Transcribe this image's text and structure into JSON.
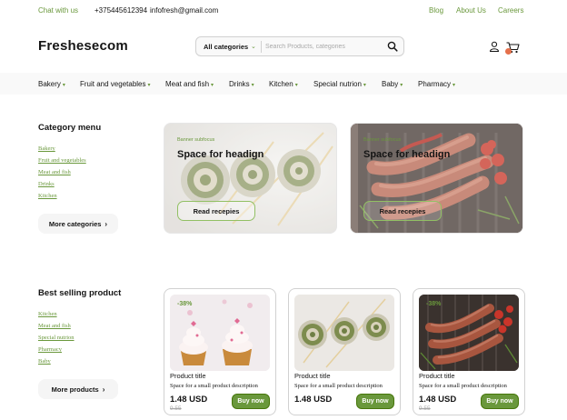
{
  "topbar": {
    "chat": "Chat with us",
    "phone": "+375445612394",
    "email": "infofresh@gmail.com",
    "links": [
      "Blog",
      "About Us",
      "Careers"
    ]
  },
  "header": {
    "logo": "Freshesecom",
    "search": {
      "category_label": "All categories",
      "placeholder": "Search Products, categories"
    }
  },
  "nav": {
    "items": [
      "Bakery",
      "Fruit and vegetables",
      "Meat and fish",
      "Drinks",
      "Kitchen",
      "Special nutrion",
      "Baby",
      "Pharmacy"
    ]
  },
  "category_menu": {
    "title": "Category menu",
    "links": [
      "Bakery",
      "Fruit and vegetables",
      "Meat and fish",
      "Drinks",
      "Kitchen"
    ],
    "button": "More categories"
  },
  "banners": [
    {
      "subtitle": "Banner subfocus",
      "heading": "Space for headign",
      "button": "Read recepies"
    },
    {
      "subtitle": "Banner subfocus",
      "heading": "Space for headign",
      "button": "Read recepies"
    }
  ],
  "best_selling": {
    "title": "Best selling product",
    "links": [
      "Kitchen",
      "Meat and fish",
      "Special nutrion",
      "Pharmacy",
      "Baby"
    ],
    "button": "More products"
  },
  "products": [
    {
      "badge": "-38%",
      "title": "Product title",
      "description": "Space for a small product description",
      "price": "1.48 USD",
      "old_price": "9.55",
      "button": "Buy now"
    },
    {
      "badge": "",
      "title": "Product title",
      "description": "Space for a small product description",
      "price": "1.48 USD",
      "old_price": "",
      "button": "Buy now"
    },
    {
      "badge": "-38%",
      "title": "Product title",
      "description": "Space for a small product description",
      "price": "1.48 USD",
      "old_price": "9.55",
      "button": "Buy now"
    }
  ],
  "colors": {
    "accent": "#6a983c",
    "accent_dark": "#46760a",
    "badge": "#e5704b",
    "text": "#151515",
    "muted": "#a9a9a9"
  }
}
